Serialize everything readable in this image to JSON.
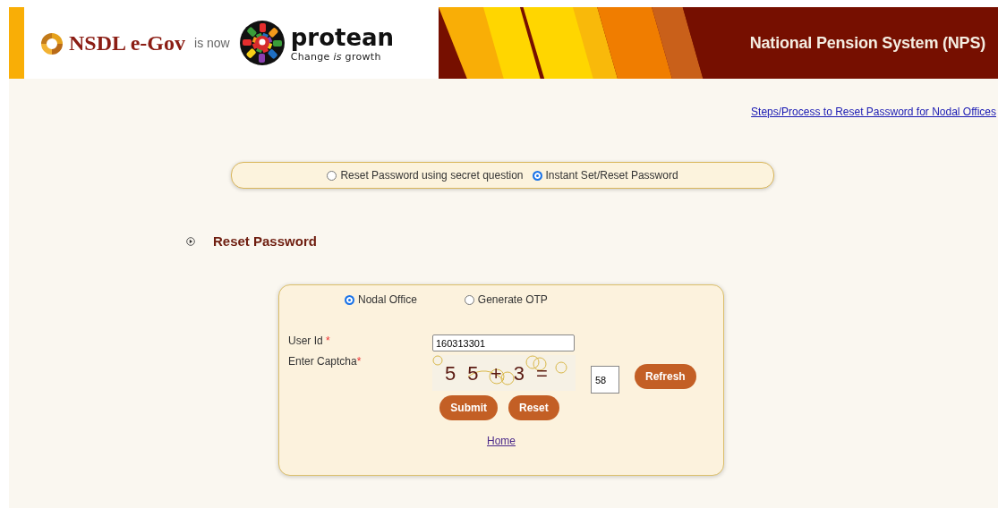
{
  "header": {
    "old_brand": "NSDL e-Gov",
    "joiner": "is now",
    "new_brand": "protean",
    "tagline": "Change *is* growth",
    "title": "National Pension System (NPS)"
  },
  "help_link": "Steps/Process to Reset Password for Nodal Offices",
  "mode_options": [
    {
      "label": "Reset Password using secret question",
      "selected": false
    },
    {
      "label": "Instant Set/Reset Password",
      "selected": true
    }
  ],
  "section_title": "Reset Password",
  "form": {
    "user_types": [
      {
        "label": "Nodal Office",
        "selected": true
      },
      {
        "label": "Generate OTP",
        "selected": false
      }
    ],
    "user_id": {
      "label": "User Id",
      "required_mark": "*",
      "value": "160313301"
    },
    "captcha": {
      "label": "Enter Captcha",
      "required_mark": "*",
      "challenge": "5 5 + 3 =",
      "value": "58",
      "refresh": "Refresh"
    },
    "buttons": [
      "Submit",
      "Reset"
    ],
    "home_link": "Home"
  }
}
